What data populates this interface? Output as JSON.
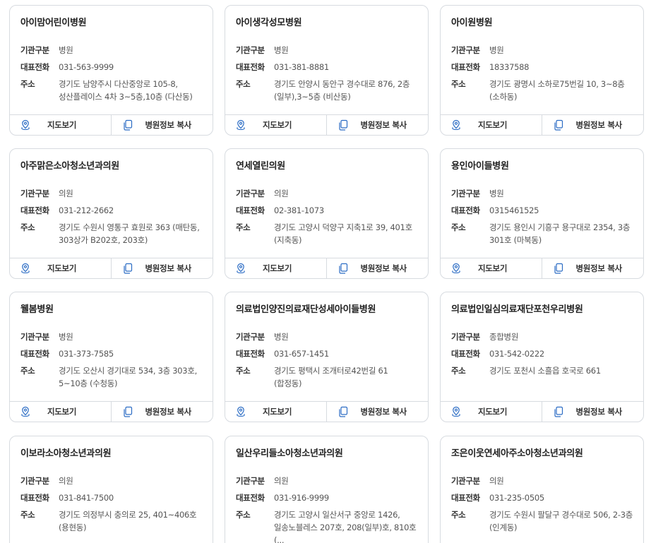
{
  "labels": {
    "type": "기관구분",
    "phone": "대표전화",
    "address": "주소",
    "map_button": "지도보기",
    "copy_button": "병원정보 복사"
  },
  "cards": [
    {
      "name": "아이맘어린이병원",
      "type": "병원",
      "phone": "031-563-9999",
      "address": "경기도 남양주시 다산중앙로 105-8, 성산플레이스 4차 3~5층,10층 (다산동)"
    },
    {
      "name": "아이생각성모병원",
      "type": "병원",
      "phone": "031-381-8881",
      "address": "경기도 안양시 동안구 경수대로 876, 2층(일부),3~5층 (비산동)"
    },
    {
      "name": "아이원병원",
      "type": "병원",
      "phone": "18337588",
      "address": "경기도 광명시 소하로75번길 10, 3~8층 (소하동)"
    },
    {
      "name": "아주맑은소아청소년과의원",
      "type": "의원",
      "phone": "031-212-2662",
      "address": "경기도 수원시 영통구 효원로 363 (매탄동, 303상가 B202호, 203호)"
    },
    {
      "name": "연세열린의원",
      "type": "의원",
      "phone": "02-381-1073",
      "address": "경기도 고양시 덕양구 지축1로 39, 401호 (지축동)"
    },
    {
      "name": "용인아이들병원",
      "type": "병원",
      "phone": "0315461525",
      "address": "경기도 용인시 기흥구 용구대로 2354, 3층 301호 (마북동)"
    },
    {
      "name": "웰봄병원",
      "type": "병원",
      "phone": "031-373-7585",
      "address": "경기도 오산시 경기대로 534, 3층 303호, 5~10층 (수청동)"
    },
    {
      "name": "의료법인양진의료재단성세아이들병원",
      "type": "병원",
      "phone": "031-657-1451",
      "address": "경기도 평택시 조개터로42번길 61 (합정동)"
    },
    {
      "name": "의료법인일심의료재단포천우리병원",
      "type": "종합병원",
      "phone": "031-542-0222",
      "address": "경기도 포천시 소흘읍 호국로 661"
    },
    {
      "name": "이보라소아청소년과의원",
      "type": "의원",
      "phone": "031-841-7500",
      "address": "경기도 의정부시 충의로 25, 401~406호 (용현동)"
    },
    {
      "name": "일산우리들소아청소년과의원",
      "type": "의원",
      "phone": "031-916-9999",
      "address": "경기도 고양시 일산서구 중앙로 1426, 일송노블레스 207호, 208(일부)호, 810호 (..."
    },
    {
      "name": "조은이웃연세아주소아청소년과의원",
      "type": "의원",
      "phone": "031-235-0505",
      "address": "경기도 수원시 팔달구 경수대로 506, 2-3층 (인계동)"
    }
  ],
  "colors": {
    "border": "#d7dbe0",
    "icon_accent": "#2b6cc4"
  }
}
